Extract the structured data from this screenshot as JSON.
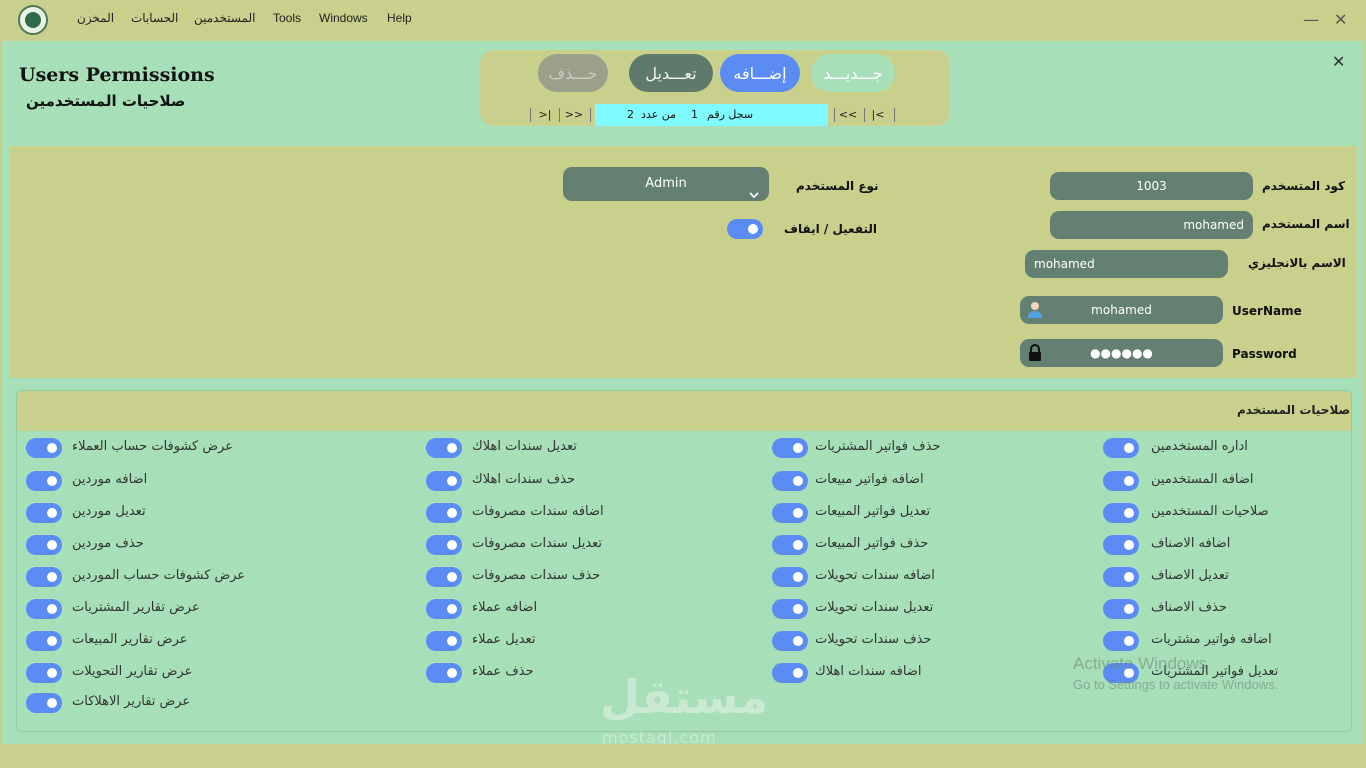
{
  "menu": {
    "store": "المخزن",
    "accounts": "الحسابات",
    "users": "المستخدمين",
    "tools": "Tools",
    "windows": "Windows",
    "help": "Help"
  },
  "window": {
    "minimize": "—",
    "close": "✕"
  },
  "header": {
    "title_en": "Users Permissions",
    "title_ar": "صلاحيات المستخدمين",
    "close": "✕"
  },
  "actions": {
    "delete": "حـــذف",
    "edit": "تعـــديل",
    "add": "إضـــافه",
    "new": "جـــديـــد"
  },
  "navigator": {
    "last": ">|",
    "next": ">>",
    "prev": "<<",
    "first": "|<",
    "record_label": "سجل رقم",
    "record_number": "1",
    "of_label": "من عدد",
    "total": "2"
  },
  "form": {
    "user_code_label": "كود المتسخدم",
    "user_code": "1003",
    "user_name_label": "اسم المستخدم",
    "user_name": "mohamed",
    "english_name_label": "الاسم بالانجليزي",
    "english_name": "mohamed",
    "username_label": "UserName",
    "username": "mohamed",
    "password_label": "Password",
    "password": "●●●●●●",
    "user_type_label": "نوع المستخدم",
    "user_type": "Admin",
    "activation_label": "التفعيل / ايقاف",
    "activation_on": true
  },
  "permissions": {
    "title": "صلاحيات المستخدم",
    "columns": [
      [
        "اداره المستخدمين",
        "اضافه المستخدمين",
        "صلاحيات المستخدمين",
        "اضافه الاصناف",
        "تعديل الاصناف",
        "حذف الاصناف",
        "اضافه فواتير مشتريات",
        "تعديل فواتير المشتريات"
      ],
      [
        "حذف فواتير المشتريات",
        "اضافه فواتير مبيعات",
        "تعديل فواتير المبيعات",
        "حذف فواتير المبيعات",
        "اضافه سندات تحويلات",
        "تعديل سندات تحويلات",
        "حذف سندات تحويلات",
        "اضافه سندات اهلاك"
      ],
      [
        "تعديل سندات اهلاك",
        "حذف سندات اهلاك",
        "اضافه سندات مصروفات",
        "تعديل سندات مصروفات",
        "حذف سندات مصروفات",
        "اضافه عملاء",
        "تعديل عملاء",
        "حذف عملاء"
      ],
      [
        "عرض كشوفات حساب العملاء",
        "اضافه موردين",
        "تعديل موردين",
        "حذف موردين",
        "عرض كشوفات حساب الموردين",
        "عرض تقارير المشتريات",
        "عرض تقارير المبيعات",
        "عرض تقارير التحويلات",
        "عرض تقارير الاهلاكات"
      ]
    ]
  },
  "overlay": {
    "watermark": "مستقل",
    "watermark_url": "mostaql.com",
    "activate_title": "Activate Windows",
    "activate_sub": "Go to Settings to activate Windows."
  },
  "colors": {
    "bar": "#c8d08c",
    "panel": "#a6dfb8",
    "field": "#638073",
    "toggle": "#5b8cf5",
    "add_pill": "#5b8cf5",
    "edit_pill": "#5d7a6c",
    "record_cell": "#7ffbff"
  }
}
